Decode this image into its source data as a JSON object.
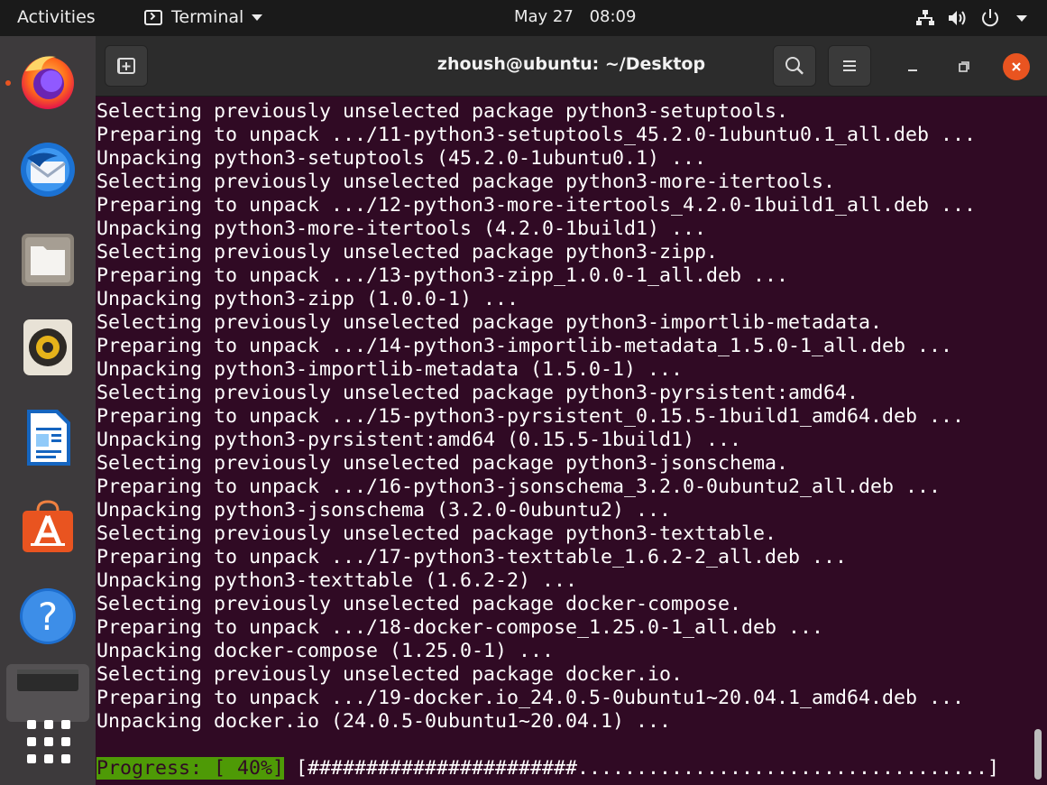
{
  "topbar": {
    "activities": "Activities",
    "app_name": "Terminal",
    "date": "May 27",
    "time": "08:09"
  },
  "window": {
    "title": "zhoush@ubuntu: ~/Desktop"
  },
  "terminal": {
    "lines": [
      "Selecting previously unselected package python3-setuptools.",
      "Preparing to unpack .../11-python3-setuptools_45.2.0-1ubuntu0.1_all.deb ...",
      "Unpacking python3-setuptools (45.2.0-1ubuntu0.1) ...",
      "Selecting previously unselected package python3-more-itertools.",
      "Preparing to unpack .../12-python3-more-itertools_4.2.0-1build1_all.deb ...",
      "Unpacking python3-more-itertools (4.2.0-1build1) ...",
      "Selecting previously unselected package python3-zipp.",
      "Preparing to unpack .../13-python3-zipp_1.0.0-1_all.deb ...",
      "Unpacking python3-zipp (1.0.0-1) ...",
      "Selecting previously unselected package python3-importlib-metadata.",
      "Preparing to unpack .../14-python3-importlib-metadata_1.5.0-1_all.deb ...",
      "Unpacking python3-importlib-metadata (1.5.0-1) ...",
      "Selecting previously unselected package python3-pyrsistent:amd64.",
      "Preparing to unpack .../15-python3-pyrsistent_0.15.5-1build1_amd64.deb ...",
      "Unpacking python3-pyrsistent:amd64 (0.15.5-1build1) ...",
      "Selecting previously unselected package python3-jsonschema.",
      "Preparing to unpack .../16-python3-jsonschema_3.2.0-0ubuntu2_all.deb ...",
      "Unpacking python3-jsonschema (3.2.0-0ubuntu2) ...",
      "Selecting previously unselected package python3-texttable.",
      "Preparing to unpack .../17-python3-texttable_1.6.2-2_all.deb ...",
      "Unpacking python3-texttable (1.6.2-2) ...",
      "Selecting previously unselected package docker-compose.",
      "Preparing to unpack .../18-docker-compose_1.25.0-1_all.deb ...",
      "Unpacking docker-compose (1.25.0-1) ...",
      "Selecting previously unselected package docker.io.",
      "Preparing to unpack .../19-docker.io_24.0.5-0ubuntu1~20.04.1_amd64.deb ...",
      "Unpacking docker.io (24.0.5-0ubuntu1~20.04.1) ..."
    ],
    "progress_label": "Progress: [ 40%]",
    "progress_bar": " [#######################...................................]",
    "progress_percent": 40
  },
  "dock": {
    "items": [
      "firefox-icon",
      "thunderbird-icon",
      "files-icon",
      "rhythmbox-icon",
      "writer-icon",
      "software-icon",
      "help-icon",
      "terminal-icon",
      "show-apps-icon"
    ]
  },
  "colors": {
    "terminal_bg": "#300a24",
    "accent": "#e95420",
    "progress_green": "#4e9a06"
  }
}
